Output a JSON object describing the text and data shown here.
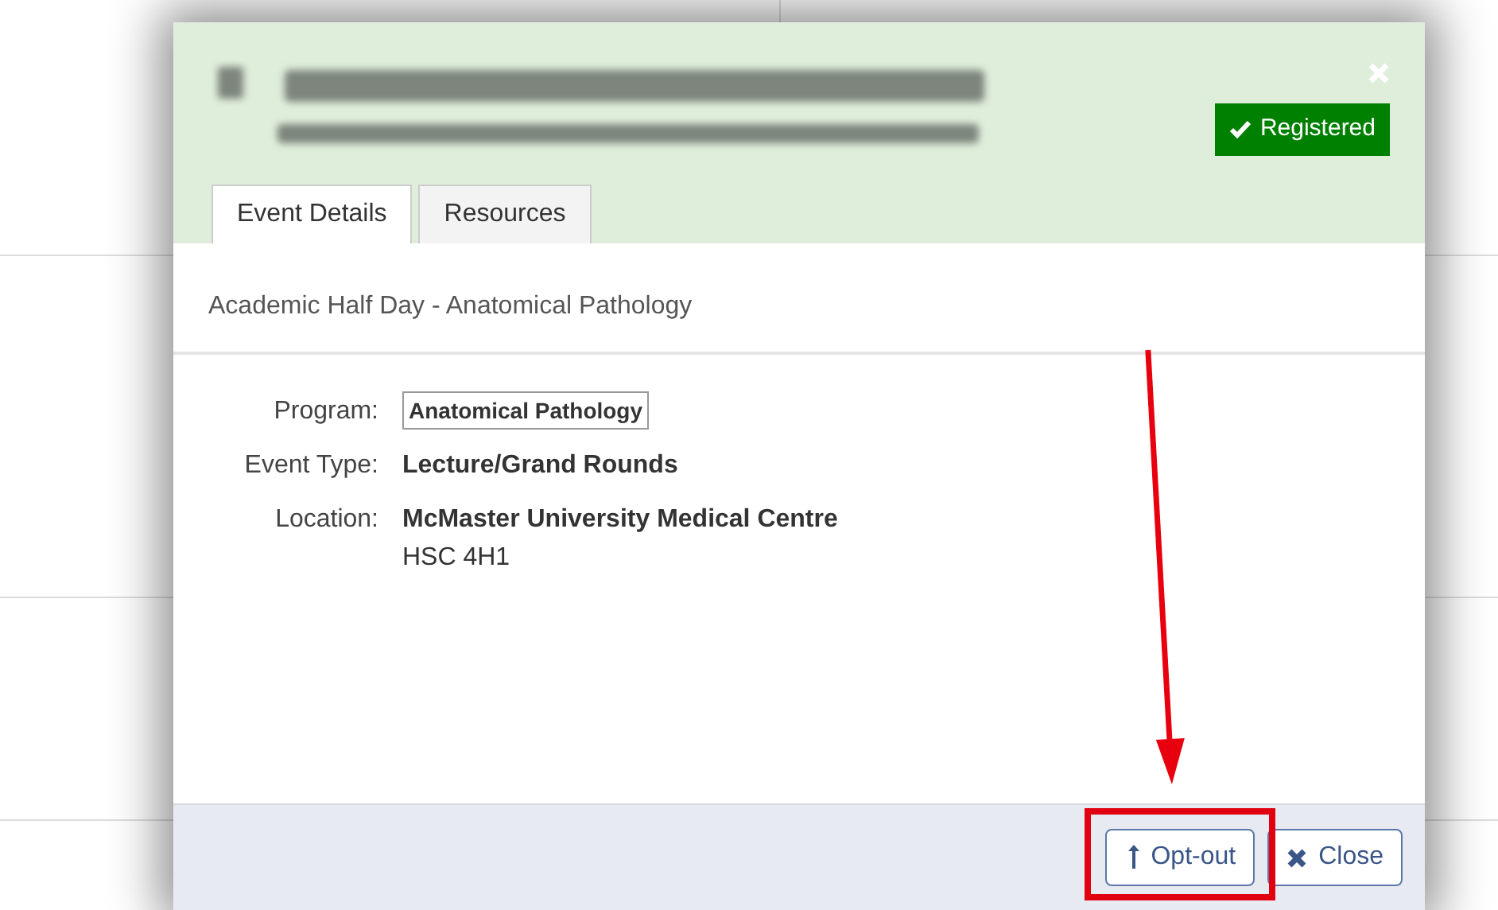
{
  "dialog": {
    "status_badge": "Registered",
    "tabs": [
      {
        "label": "Event Details",
        "selected": true
      },
      {
        "label": "Resources",
        "selected": false
      }
    ],
    "description": "Academic Half Day - Anatomical Pathology",
    "fields": [
      {
        "label": "Program:",
        "kind": "tag",
        "value": "Anatomical Pathology"
      },
      {
        "label": "Event Type:",
        "kind": "text",
        "value": "Lecture/Grand Rounds"
      },
      {
        "label": "Location:",
        "kind": "text",
        "value": "McMaster University Medical Centre",
        "detail": "HSC 4H1"
      }
    ],
    "buttons": [
      {
        "label": "Opt-out",
        "kind": "opt-out",
        "highlighted": true
      },
      {
        "label": "Close",
        "kind": "close",
        "highlighted": false
      }
    ]
  }
}
